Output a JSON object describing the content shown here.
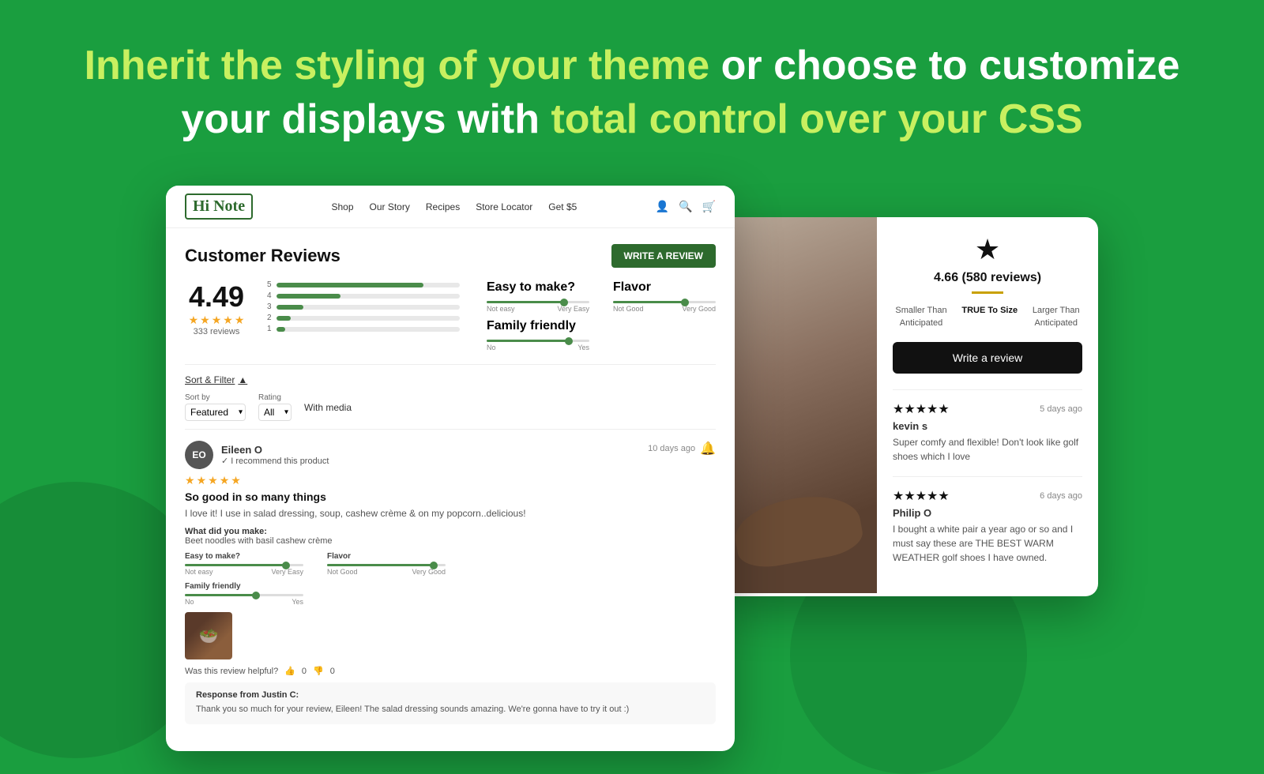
{
  "hero": {
    "title_part1": "Inherit the styling of your theme",
    "title_connector": " or choose to customize",
    "title_part2": "your displays with ",
    "title_highlight": "total control over your CSS"
  },
  "left_screen": {
    "store": {
      "logo": "Hi Note",
      "nav_links": [
        "Shop",
        "Our Story",
        "Recipes",
        "Store Locator",
        "Get $5"
      ]
    },
    "reviews_title": "Customer Reviews",
    "write_review_btn": "WRITE A REVIEW",
    "overall_rating": "4.49",
    "review_count": "333 reviews",
    "bars": [
      {
        "label": "5",
        "width": "80"
      },
      {
        "label": "4",
        "width": "35"
      },
      {
        "label": "3",
        "width": "15"
      },
      {
        "label": "2",
        "width": "8"
      },
      {
        "label": "1",
        "width": "5"
      }
    ],
    "attributes": [
      {
        "label": "Easy to make?",
        "left_label": "Not easy",
        "right_label": "Very Easy",
        "thumb_pos": "75"
      },
      {
        "label": "Flavor",
        "left_label": "Not Good",
        "right_label": "Very Good",
        "thumb_pos": "70"
      },
      {
        "label": "Family friendly",
        "left_label": "No",
        "right_label": "Yes",
        "thumb_pos": "80"
      }
    ],
    "sort_filter_label": "Sort & Filter",
    "sort_by_label": "Sort by",
    "sort_by_value": "Featured",
    "rating_label": "Rating",
    "rating_value": "All",
    "with_media_label": "With media",
    "review": {
      "avatar_initials": "EO",
      "reviewer_name": "Eileen O",
      "verified": "✓ I recommend this product",
      "date": "10 days ago",
      "stars": 5,
      "title": "So good in so many things",
      "text": "I love it! I use in salad dressing, soup, cashew crème & on my popcorn..delicious!",
      "what_made_label": "What did you make:",
      "what_made_value": "Beet noodles with basil cashew crème",
      "attrs": [
        {
          "label": "Easy to make?",
          "left": "Not easy",
          "right": "Very Easy",
          "thumb_pos": "85"
        },
        {
          "label": "Flavor",
          "left": "Not Good",
          "right": "Very Good",
          "thumb_pos": "90"
        },
        {
          "label": "Family friendly",
          "left": "No",
          "right": "Yes",
          "thumb_pos": "60"
        }
      ],
      "helpful_text": "Was this review helpful?",
      "helpful_yes": "0",
      "helpful_no": "0",
      "response_from": "Response from Justin C:",
      "response_text": "Thank you so much for your review, Eileen! The salad dressing sounds amazing. We're gonna have to try it out :)"
    }
  },
  "right_screen": {
    "star_icon": "★",
    "rating": "4.66 (580 reviews)",
    "fit_indicators": [
      {
        "label": "Smaller Than\nAnticipated",
        "active": false
      },
      {
        "label": "TRUE To Size",
        "active": true
      },
      {
        "label": "Larger Than\nAnticipated",
        "active": false
      }
    ],
    "write_review_btn": "Write a review",
    "reviews": [
      {
        "stars": 5,
        "star_text": "★★★★★",
        "date": "5 days ago",
        "reviewer": "kevin s",
        "text": "Super comfy and flexible! Don't look like golf shoes which I love"
      },
      {
        "stars": 5,
        "star_text": "★★★★★",
        "date": "6 days ago",
        "reviewer": "Philip O",
        "text": "I bought a white pair a year ago or so and I must say these are THE BEST WARM WEATHER golf shoes I have owned."
      }
    ]
  }
}
